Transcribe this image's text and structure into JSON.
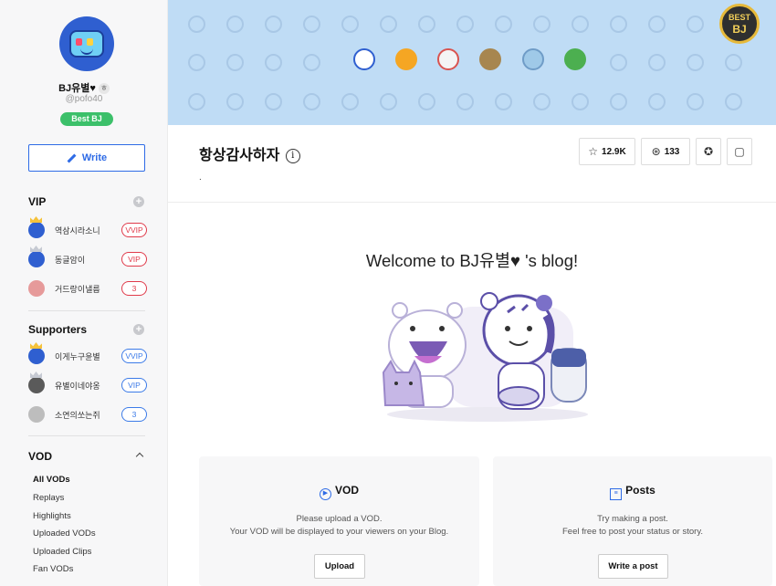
{
  "profile": {
    "name": "BJ유별♥",
    "name_icon": "ㅎ",
    "id": "@pofo40",
    "badge": "Best BJ"
  },
  "sidebar": {
    "write_label": "Write",
    "vip_title": "VIP",
    "vip_members": [
      {
        "name": "역삼시라소니",
        "badge": "VVIP"
      },
      {
        "name": "동글암이",
        "badge": "VIP"
      },
      {
        "name": "거드랑이낼름",
        "badge": "3"
      }
    ],
    "supporters_title": "Supporters",
    "supporters": [
      {
        "name": "이게누구윤별",
        "badge": "VVIP"
      },
      {
        "name": "유별이네야옹",
        "badge": "VIP"
      },
      {
        "name": "소연의쏘는쥐",
        "badge": "3"
      }
    ],
    "vod_title": "VOD",
    "vod_items": [
      "All VODs",
      "Replays",
      "Highlights",
      "Uploaded VODs",
      "Uploaded Clips",
      "Fan VODs"
    ]
  },
  "banner": {
    "best_bj_line1": "BEST",
    "best_bj_line2": "BJ"
  },
  "blog": {
    "title": "항상감사하자",
    "info_icon": "i",
    "subtitle": ".",
    "subscribers": "12.9K",
    "fans": "133"
  },
  "welcome_text": "Welcome to BJ유별♥ 's blog!",
  "vod_card": {
    "title": "VOD",
    "line1": "Please upload a VOD.",
    "line2": "Your VOD will be displayed to your viewers on your Blog.",
    "button": "Upload"
  },
  "posts_card": {
    "title": "Posts",
    "line1": "Try making a post.",
    "line2": "Feel free to post your status or story.",
    "button": "Write a post"
  },
  "colors": {
    "accent": "#2e6be6",
    "banner_bg": "#bfdcf5",
    "best_badge": "#3cc06a",
    "vip_red": "#e03b4b",
    "vip_blue": "#3c7be8"
  }
}
